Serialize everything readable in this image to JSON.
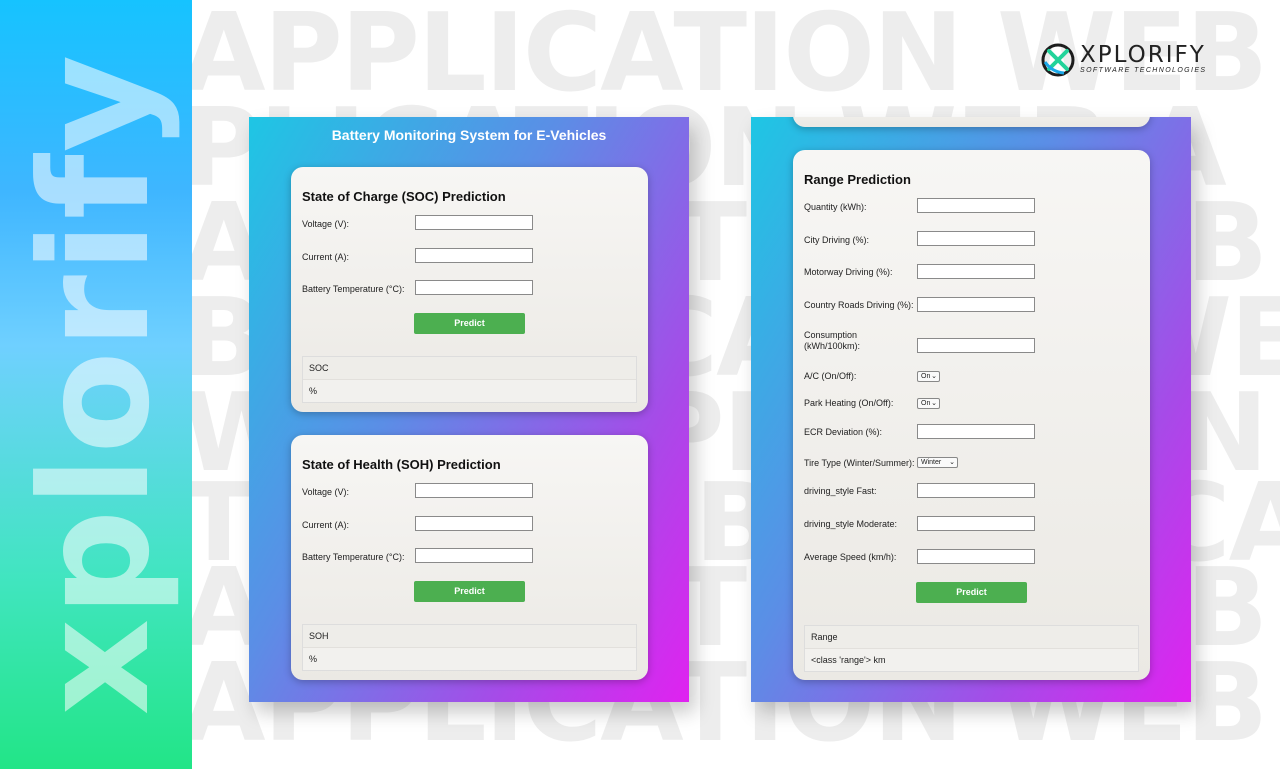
{
  "brand": {
    "vertical_text": "xplorify"
  },
  "watermark": {
    "lines": [
      "APPLICATION WEB",
      "PLICATION WEB A",
      "APPLICATION WEB A",
      "B APPLICATION WEB",
      "WEB APPLICATION WE",
      "TION WEB APPLICATI",
      "APPLICATION WEB A",
      "APPLICATION WEB"
    ]
  },
  "logo": {
    "name": "XPLORIFY",
    "tagline": "SOFTWARE TECHNOLOGIES"
  },
  "left_panel": {
    "title": "Battery Monitoring System for E-Vehicles",
    "soc": {
      "heading": "State of Charge (SOC) Prediction",
      "voltage_label": "Voltage (V):",
      "current_label": "Current (A):",
      "temp_label": "Battery Temperature (°C):",
      "voltage_value": "",
      "current_value": "",
      "temp_value": "",
      "button": "Predict",
      "result_header": "SOC",
      "result_value": "%"
    },
    "soh": {
      "heading": "State of Health (SOH) Prediction",
      "voltage_label": "Voltage (V):",
      "current_label": "Current (A):",
      "temp_label": "Battery Temperature (°C):",
      "voltage_value": "",
      "current_value": "",
      "temp_value": "",
      "button": "Predict",
      "result_header": "SOH",
      "result_value": "%"
    }
  },
  "right_panel": {
    "range": {
      "heading": "Range Prediction",
      "quantity_label": "Quantity (kWh):",
      "city_label": "City Driving (%):",
      "motorway_label": "Motorway Driving (%):",
      "country_label": "Country Roads Driving (%):",
      "consumption_label_1": "Consumption",
      "consumption_label_2": "(kWh/100km):",
      "ac_label": "A/C (On/Off):",
      "ac_value": "On",
      "park_label": "Park Heating (On/Off):",
      "park_value": "On",
      "ecr_label": "ECR Deviation (%):",
      "tire_label": "Tire Type (Winter/Summer):",
      "tire_value": "Winter",
      "fast_label": "driving_style Fast:",
      "moderate_label": "driving_style Moderate:",
      "speed_label": "Average Speed (km/h):",
      "button": "Predict",
      "result_header": "Range",
      "result_value": "<class 'range'> km"
    }
  },
  "colors": {
    "accent": "#4caf50",
    "panel_start": "#1ec6e4",
    "panel_end": "#e022f0"
  }
}
